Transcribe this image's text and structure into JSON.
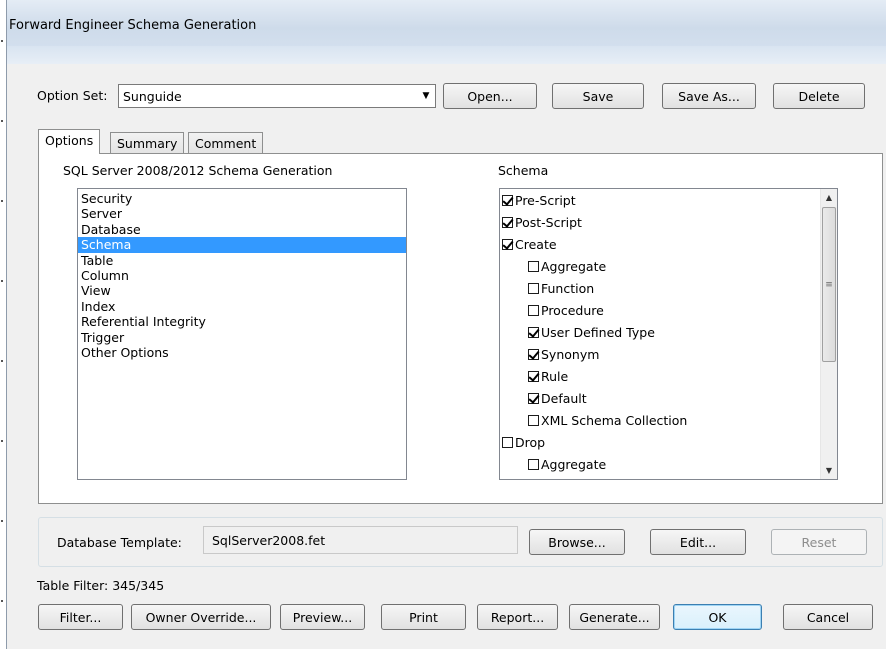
{
  "window": {
    "title": "Forward Engineer Schema Generation"
  },
  "option_set": {
    "label": "Option Set:",
    "value": "Sunguide",
    "buttons": {
      "open": "Open...",
      "save": "Save",
      "save_as": "Save As...",
      "delete": "Delete"
    }
  },
  "tabs": [
    {
      "label": "Options",
      "active": true
    },
    {
      "label": "Summary",
      "active": false
    },
    {
      "label": "Comment",
      "active": false
    }
  ],
  "left_panel": {
    "heading": "SQL Server 2008/2012 Schema Generation",
    "items": [
      "Security",
      "Server",
      "Database",
      "Schema",
      "Table",
      "Column",
      "View",
      "Index",
      "Referential Integrity",
      "Trigger",
      "Other Options"
    ],
    "selected": "Schema"
  },
  "right_panel": {
    "heading": "Schema",
    "tree": [
      {
        "label": "Pre-Script",
        "checked": true,
        "level": 0
      },
      {
        "label": "Post-Script",
        "checked": true,
        "level": 0
      },
      {
        "label": "Create",
        "checked": true,
        "level": 0
      },
      {
        "label": "Aggregate",
        "checked": false,
        "level": 1
      },
      {
        "label": "Function",
        "checked": false,
        "level": 1
      },
      {
        "label": "Procedure",
        "checked": false,
        "level": 1
      },
      {
        "label": "User Defined Type",
        "checked": true,
        "level": 1
      },
      {
        "label": "Synonym",
        "checked": true,
        "level": 1
      },
      {
        "label": "Rule",
        "checked": true,
        "level": 1
      },
      {
        "label": "Default",
        "checked": true,
        "level": 1
      },
      {
        "label": "XML Schema Collection",
        "checked": false,
        "level": 1
      },
      {
        "label": "Drop",
        "checked": false,
        "level": 0
      },
      {
        "label": "Aggregate",
        "checked": false,
        "level": 1
      }
    ]
  },
  "template": {
    "label": "Database Template:",
    "value": "SqlServer2008.fet",
    "buttons": {
      "browse": "Browse...",
      "edit": "Edit...",
      "reset": "Reset"
    }
  },
  "table_filter": "Table Filter: 345/345",
  "bottom_buttons": {
    "filter": "Filter...",
    "owner_override": "Owner Override...",
    "preview": "Preview...",
    "print": "Print",
    "report": "Report...",
    "generate": "Generate...",
    "ok": "OK",
    "cancel": "Cancel"
  },
  "icons": {
    "combo_arrow": "chevron-down-icon",
    "scroll_up": "scroll-up-icon",
    "scroll_down": "scroll-down-icon",
    "checkbox": "checkbox-icon"
  },
  "colors": {
    "selection": "#3399ff",
    "titlebar": "#cedbea",
    "default_button_border": "#3c7fb1"
  }
}
